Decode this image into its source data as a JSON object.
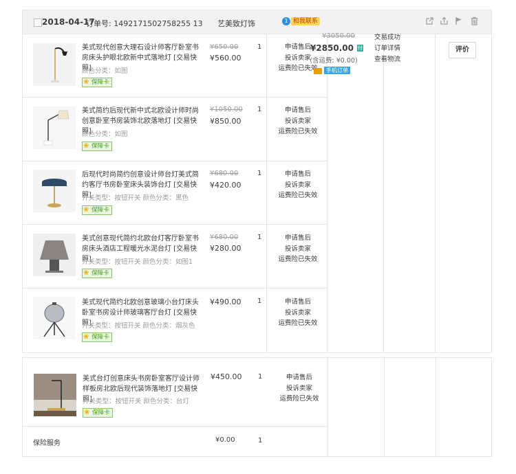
{
  "order": {
    "date": "2018-04-17",
    "order_no": "订单号: 1492171502758255 13",
    "shop": "艺美致灯饰",
    "contact": "和我联系",
    "contact_icon": "1",
    "header_icons": [
      "share-icon",
      "upload-icon",
      "flag-icon",
      "trash-icon"
    ],
    "total_original": "¥3050.00",
    "total": "¥2850.00",
    "pay_badge": "付",
    "shipping": "(含运费: ¥0.00)",
    "mobile_tag": "手机订单",
    "status": {
      "success": "交易成功",
      "detail": "订单详情",
      "logistics": "查看物流"
    },
    "rate_label": "评价"
  },
  "items": [
    {
      "title": "美式现代创意大理石设计师客厅卧室书房床头护眼北欧新中式落地灯 [交易快照]",
      "sku": "颜色分类：如图",
      "badge": "保障卡",
      "old_price": "¥650.00",
      "price": "¥560.00",
      "qty": "1",
      "services": [
        "申请售后",
        "投诉卖家",
        "运费险已失效"
      ]
    },
    {
      "title": "美式简约后现代新中式北欧设计师时尚创意卧室书房装饰北欧落地灯 [交易快照]",
      "sku": "颜色分类：如图",
      "badge": "保障卡",
      "old_price": "¥1050.00",
      "price": "¥850.00",
      "qty": "1",
      "services": [
        "申请售后",
        "投诉卖家",
        "运费险已失效"
      ]
    },
    {
      "title": "后现代时尚简约创意设计师台灯美式简约客厅书房卧室床头装饰台灯 [交易快照]",
      "sku": "开关类型：按钮开关   颜色分类：黑色",
      "badge": "保障卡",
      "old_price": "¥680.00",
      "price": "¥420.00",
      "qty": "1",
      "services": [
        "申请售后",
        "投诉卖家",
        "运费险已失效"
      ]
    },
    {
      "title": "美式创意现代简约北欧台灯客厅卧室书房床头酒店工程暖光水泥台灯 [交易快照]",
      "sku": "开关类型：按钮开关   颜色分类：如图1",
      "badge": "保障卡",
      "old_price": "¥680.00",
      "price": "¥280.00",
      "qty": "1",
      "services": [
        "申请售后",
        "投诉卖家",
        "运费险已失效"
      ]
    },
    {
      "title": "美式现代简约北欧创意玻璃小台灯床头卧室书房设计师玻璃客厅台灯 [交易快照]",
      "sku": "开关类型：按钮开关   颜色分类：烟灰色",
      "badge": "保障卡",
      "old_price": "",
      "price": "¥490.00",
      "qty": "1",
      "services": [
        "申请售后",
        "投诉卖家",
        "运费险已失效"
      ]
    },
    {
      "title": "美式台灯创意床头书房卧室客厅设计师样板房北欧后现代装饰落地灯 [交易快照]",
      "sku": "开关类型：按钮开关   颜色分类：台灯",
      "badge": "保障卡",
      "old_price": "",
      "price": "¥450.00",
      "qty": "1",
      "services": [
        "申请售后",
        "投诉卖家",
        "运费险已失效"
      ]
    }
  ],
  "insurance": {
    "label": "保险服务",
    "price": "¥0.00",
    "qty": "1"
  }
}
